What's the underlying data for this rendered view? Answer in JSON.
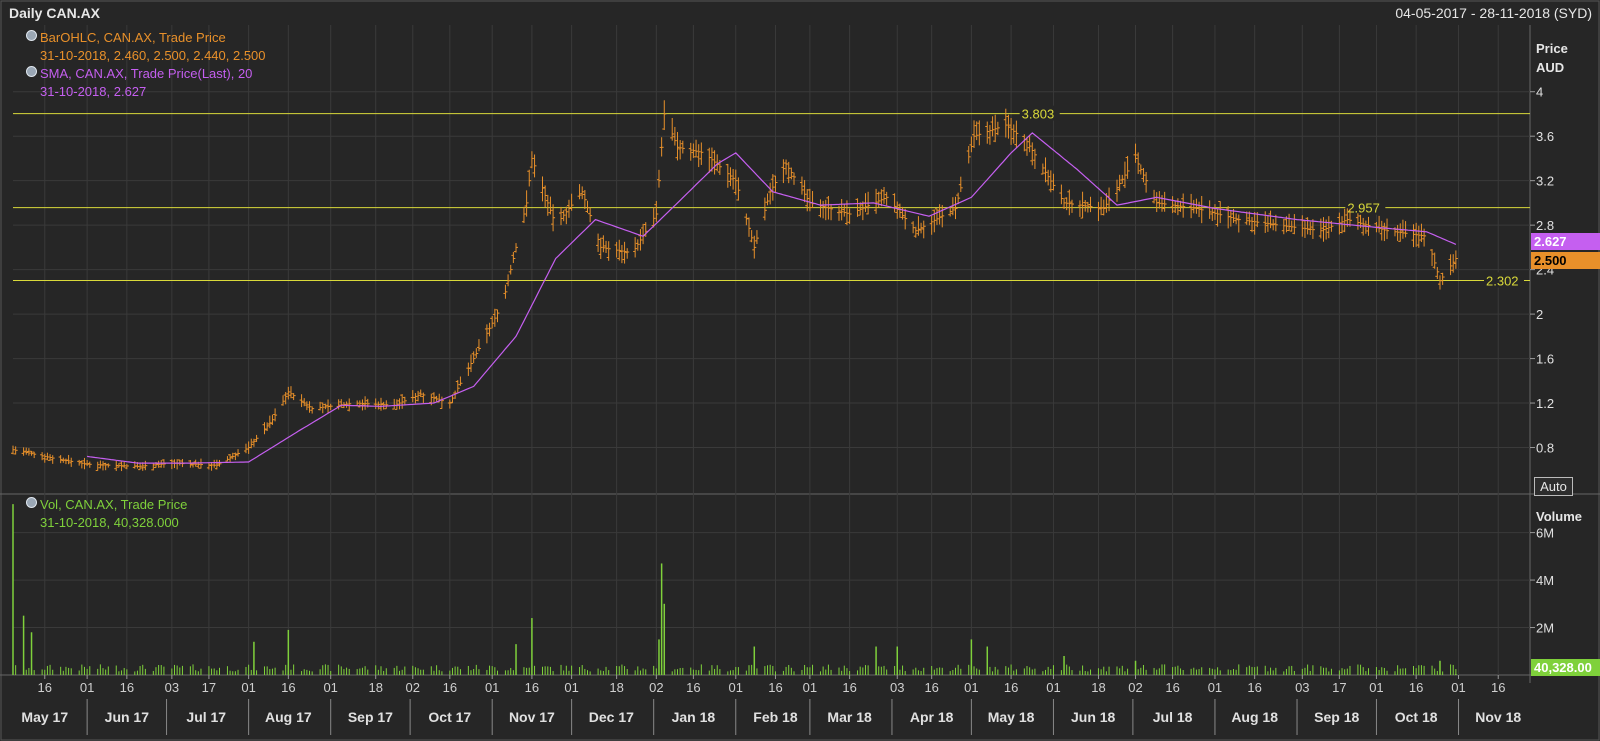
{
  "header": {
    "title": "Daily CAN.AX",
    "range": "04-05-2017 - 28-11-2018 (SYD)"
  },
  "legend": {
    "ohlc_name": "BarOHLC, CAN.AX, Trade Price",
    "ohlc_values": "31-10-2018, 2.460, 2.500, 2.440, 2.500",
    "sma_name": "SMA, CAN.AX, Trade Price(Last),  20",
    "sma_values": "31-10-2018, 2.627",
    "vol_name": "Vol, CAN.AX, Trade Price",
    "vol_values": "31-10-2018, 40,328.000"
  },
  "price_axis": {
    "title_line1": "Price",
    "title_line2": "AUD"
  },
  "volume_axis": {
    "title": "Volume"
  },
  "auto_button": "Auto",
  "last_tags": {
    "sma": "2.627",
    "price": "2.500",
    "volume": "40,328.00"
  },
  "colors": {
    "background": "#262626",
    "grid": "#3a3a3a",
    "ohlc": "#e8902a",
    "sma": "#c55ff0",
    "volume": "#7fd13b",
    "hline": "#d9d93a",
    "text": "#dddddd"
  },
  "chart_data": {
    "type": "ohlc",
    "symbol": "CAN.AX",
    "ylim": [
      0.4,
      4.6
    ],
    "y_ticks": [
      0.8,
      1.2,
      1.6,
      2,
      2.4,
      2.8,
      3.2,
      3.6,
      4
    ],
    "vol_ylim": [
      0,
      7500000
    ],
    "vol_ticks": [
      {
        "v": 2000000,
        "label": "2M"
      },
      {
        "v": 4000000,
        "label": "4M"
      },
      {
        "v": 6000000,
        "label": "6M"
      }
    ],
    "horizontal_lines": [
      {
        "value": 3.803,
        "label": "3.803",
        "label_date": "2018-05-20"
      },
      {
        "value": 2.957,
        "label": "2.957",
        "label_date": "2018-09-20"
      },
      {
        "value": 2.302,
        "label": "2.302",
        "label_date": "end"
      }
    ],
    "day_ticks": [
      {
        "date": "2017-05-16",
        "label": "16"
      },
      {
        "date": "2017-06-01",
        "label": "01"
      },
      {
        "date": "2017-06-16",
        "label": "16"
      },
      {
        "date": "2017-07-03",
        "label": "03"
      },
      {
        "date": "2017-07-17",
        "label": "17"
      },
      {
        "date": "2017-08-01",
        "label": "01"
      },
      {
        "date": "2017-08-16",
        "label": "16"
      },
      {
        "date": "2017-09-01",
        "label": "01"
      },
      {
        "date": "2017-09-18",
        "label": "18"
      },
      {
        "date": "2017-10-02",
        "label": "02"
      },
      {
        "date": "2017-10-16",
        "label": "16"
      },
      {
        "date": "2017-11-01",
        "label": "01"
      },
      {
        "date": "2017-11-16",
        "label": "16"
      },
      {
        "date": "2017-12-01",
        "label": "01"
      },
      {
        "date": "2017-12-18",
        "label": "18"
      },
      {
        "date": "2018-01-02",
        "label": "02"
      },
      {
        "date": "2018-01-16",
        "label": "16"
      },
      {
        "date": "2018-02-01",
        "label": "01"
      },
      {
        "date": "2018-02-16",
        "label": "16"
      },
      {
        "date": "2018-03-01",
        "label": "01"
      },
      {
        "date": "2018-03-16",
        "label": "16"
      },
      {
        "date": "2018-04-03",
        "label": "03"
      },
      {
        "date": "2018-04-16",
        "label": "16"
      },
      {
        "date": "2018-05-01",
        "label": "01"
      },
      {
        "date": "2018-05-16",
        "label": "16"
      },
      {
        "date": "2018-06-01",
        "label": "01"
      },
      {
        "date": "2018-06-18",
        "label": "18"
      },
      {
        "date": "2018-07-02",
        "label": "02"
      },
      {
        "date": "2018-07-16",
        "label": "16"
      },
      {
        "date": "2018-08-01",
        "label": "01"
      },
      {
        "date": "2018-08-16",
        "label": "16"
      },
      {
        "date": "2018-09-03",
        "label": "03"
      },
      {
        "date": "2018-09-17",
        "label": "17"
      },
      {
        "date": "2018-10-01",
        "label": "01"
      },
      {
        "date": "2018-10-16",
        "label": "16"
      },
      {
        "date": "2018-11-01",
        "label": "01"
      },
      {
        "date": "2018-11-16",
        "label": "16"
      }
    ],
    "month_labels": [
      {
        "date": "2017-05-16",
        "label": "May 17"
      },
      {
        "date": "2017-06-16",
        "label": "Jun 17"
      },
      {
        "date": "2017-07-16",
        "label": "Jul 17"
      },
      {
        "date": "2017-08-16",
        "label": "Aug 17"
      },
      {
        "date": "2017-09-16",
        "label": "Sep 17"
      },
      {
        "date": "2017-10-16",
        "label": "Oct 17"
      },
      {
        "date": "2017-11-16",
        "label": "Nov 17"
      },
      {
        "date": "2017-12-16",
        "label": "Dec 17"
      },
      {
        "date": "2018-01-16",
        "label": "Jan 18"
      },
      {
        "date": "2018-02-16",
        "label": "Feb 18"
      },
      {
        "date": "2018-03-16",
        "label": "Mar 18"
      },
      {
        "date": "2018-04-16",
        "label": "Apr 18"
      },
      {
        "date": "2018-05-16",
        "label": "May 18"
      },
      {
        "date": "2018-06-16",
        "label": "Jun 18"
      },
      {
        "date": "2018-07-16",
        "label": "Jul 18"
      },
      {
        "date": "2018-08-16",
        "label": "Aug 18"
      },
      {
        "date": "2018-09-16",
        "label": "Sep 18"
      },
      {
        "date": "2018-10-16",
        "label": "Oct 18"
      },
      {
        "date": "2018-11-16",
        "label": "Nov 18"
      }
    ],
    "price_series": [
      {
        "date": "2017-05-04",
        "close": 0.78
      },
      {
        "date": "2017-05-20",
        "close": 0.7
      },
      {
        "date": "2017-06-01",
        "close": 0.65
      },
      {
        "date": "2017-06-20",
        "close": 0.63
      },
      {
        "date": "2017-07-03",
        "close": 0.66
      },
      {
        "date": "2017-07-20",
        "close": 0.64
      },
      {
        "date": "2017-08-01",
        "close": 0.8
      },
      {
        "date": "2017-08-10",
        "close": 1.05
      },
      {
        "date": "2017-08-16",
        "close": 1.3
      },
      {
        "date": "2017-08-25",
        "close": 1.15
      },
      {
        "date": "2017-09-10",
        "close": 1.2
      },
      {
        "date": "2017-09-25",
        "close": 1.18
      },
      {
        "date": "2017-10-05",
        "close": 1.28
      },
      {
        "date": "2017-10-16",
        "close": 1.2
      },
      {
        "date": "2017-10-25",
        "close": 1.6
      },
      {
        "date": "2017-11-05",
        "close": 2.1
      },
      {
        "date": "2017-11-14",
        "close": 3.0
      },
      {
        "date": "2017-11-16",
        "close": 3.4
      },
      {
        "date": "2017-11-25",
        "close": 2.8
      },
      {
        "date": "2017-12-05",
        "close": 3.1
      },
      {
        "date": "2017-12-12",
        "close": 2.6
      },
      {
        "date": "2017-12-24",
        "close": 2.55
      },
      {
        "date": "2018-01-02",
        "close": 2.9
      },
      {
        "date": "2018-01-05",
        "close": 3.8
      },
      {
        "date": "2018-01-10",
        "close": 3.5
      },
      {
        "date": "2018-01-20",
        "close": 3.45
      },
      {
        "date": "2018-02-01",
        "close": 3.2
      },
      {
        "date": "2018-02-08",
        "close": 2.6
      },
      {
        "date": "2018-02-14",
        "close": 3.1
      },
      {
        "date": "2018-02-20",
        "close": 3.35
      },
      {
        "date": "2018-03-01",
        "close": 3.0
      },
      {
        "date": "2018-03-16",
        "close": 2.9
      },
      {
        "date": "2018-03-30",
        "close": 3.05
      },
      {
        "date": "2018-04-10",
        "close": 2.75
      },
      {
        "date": "2018-04-25",
        "close": 2.95
      },
      {
        "date": "2018-05-02",
        "close": 3.6
      },
      {
        "date": "2018-05-14",
        "close": 3.7
      },
      {
        "date": "2018-05-22",
        "close": 3.55
      },
      {
        "date": "2018-06-05",
        "close": 3.0
      },
      {
        "date": "2018-06-20",
        "close": 2.95
      },
      {
        "date": "2018-07-02",
        "close": 3.4
      },
      {
        "date": "2018-07-10",
        "close": 3.0
      },
      {
        "date": "2018-07-25",
        "close": 2.95
      },
      {
        "date": "2018-08-10",
        "close": 2.85
      },
      {
        "date": "2018-08-25",
        "close": 2.8
      },
      {
        "date": "2018-09-10",
        "close": 2.75
      },
      {
        "date": "2018-09-20",
        "close": 2.85
      },
      {
        "date": "2018-10-05",
        "close": 2.75
      },
      {
        "date": "2018-10-20",
        "close": 2.7
      },
      {
        "date": "2018-10-25",
        "close": 2.3
      },
      {
        "date": "2018-10-31",
        "close": 2.5
      }
    ],
    "sma_series": [
      {
        "date": "2017-06-01",
        "value": 0.72
      },
      {
        "date": "2017-06-20",
        "value": 0.66
      },
      {
        "date": "2017-07-10",
        "value": 0.66
      },
      {
        "date": "2017-08-01",
        "value": 0.67
      },
      {
        "date": "2017-08-20",
        "value": 0.95
      },
      {
        "date": "2017-09-05",
        "value": 1.18
      },
      {
        "date": "2017-09-20",
        "value": 1.17
      },
      {
        "date": "2017-10-10",
        "value": 1.2
      },
      {
        "date": "2017-10-25",
        "value": 1.35
      },
      {
        "date": "2017-11-10",
        "value": 1.8
      },
      {
        "date": "2017-11-25",
        "value": 2.5
      },
      {
        "date": "2017-12-10",
        "value": 2.85
      },
      {
        "date": "2017-12-28",
        "value": 2.7
      },
      {
        "date": "2018-01-10",
        "value": 3.0
      },
      {
        "date": "2018-01-25",
        "value": 3.35
      },
      {
        "date": "2018-02-01",
        "value": 3.45
      },
      {
        "date": "2018-02-15",
        "value": 3.1
      },
      {
        "date": "2018-03-05",
        "value": 2.98
      },
      {
        "date": "2018-03-25",
        "value": 3.0
      },
      {
        "date": "2018-04-15",
        "value": 2.88
      },
      {
        "date": "2018-05-01",
        "value": 3.05
      },
      {
        "date": "2018-05-16",
        "value": 3.45
      },
      {
        "date": "2018-05-24",
        "value": 3.63
      },
      {
        "date": "2018-06-10",
        "value": 3.3
      },
      {
        "date": "2018-06-25",
        "value": 2.98
      },
      {
        "date": "2018-07-10",
        "value": 3.05
      },
      {
        "date": "2018-08-01",
        "value": 2.95
      },
      {
        "date": "2018-09-01",
        "value": 2.85
      },
      {
        "date": "2018-10-01",
        "value": 2.78
      },
      {
        "date": "2018-10-20",
        "value": 2.74
      },
      {
        "date": "2018-10-31",
        "value": 2.627
      }
    ],
    "volume_series": [
      {
        "date": "2017-05-04",
        "value": 7200000
      },
      {
        "date": "2017-05-08",
        "value": 2500000
      },
      {
        "date": "2017-05-11",
        "value": 1800000
      },
      {
        "date": "2017-08-16",
        "value": 1900000
      },
      {
        "date": "2017-08-03",
        "value": 1400000
      },
      {
        "date": "2017-11-16",
        "value": 2400000
      },
      {
        "date": "2017-11-10",
        "value": 1300000
      },
      {
        "date": "2018-01-04",
        "value": 4700000
      },
      {
        "date": "2018-01-05",
        "value": 3000000
      },
      {
        "date": "2018-01-03",
        "value": 1500000
      },
      {
        "date": "2018-02-08",
        "value": 1200000
      },
      {
        "date": "2018-03-26",
        "value": 1200000
      },
      {
        "date": "2018-04-03",
        "value": 1200000
      },
      {
        "date": "2018-05-01",
        "value": 1500000
      },
      {
        "date": "2018-05-07",
        "value": 1200000
      },
      {
        "date": "2018-06-05",
        "value": 800000
      },
      {
        "date": "2018-07-02",
        "value": 600000
      },
      {
        "date": "2018-10-25",
        "value": 600000
      },
      {
        "date": "2018-10-31",
        "value": 40328
      }
    ]
  }
}
